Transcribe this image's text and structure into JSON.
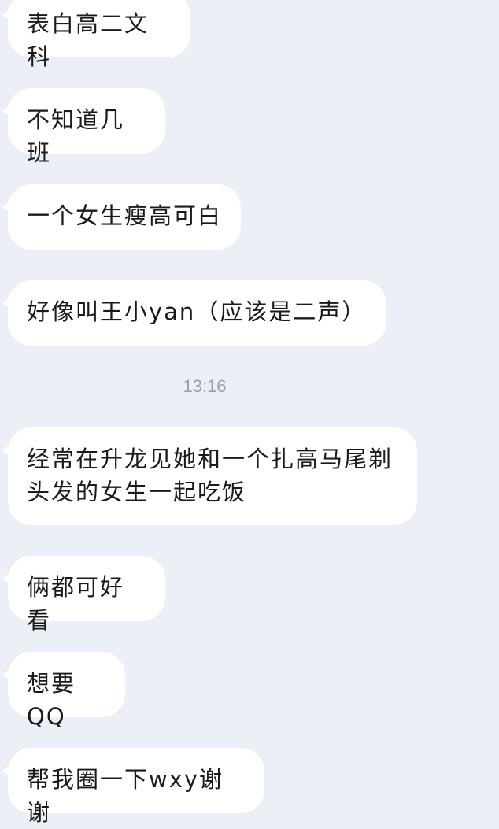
{
  "messages": [
    {
      "text": "表白高二文科"
    },
    {
      "text": "不知道几班"
    },
    {
      "text": "一个女生瘦高可白"
    },
    {
      "text": "好像叫王小yan（应该是二声）"
    },
    {
      "text": "经常在升龙见她和一个扎高马尾剃头发的女生一起吃饭"
    },
    {
      "text": "俩都可好看"
    },
    {
      "text": "想要QQ"
    },
    {
      "text": "帮我圈一下wxy谢谢"
    }
  ],
  "timestamp": "13:16",
  "colors": {
    "background": "#eceff5",
    "bubble": "#ffffff",
    "text": "#1a1a1a",
    "timestamp": "#9aa0aa"
  }
}
